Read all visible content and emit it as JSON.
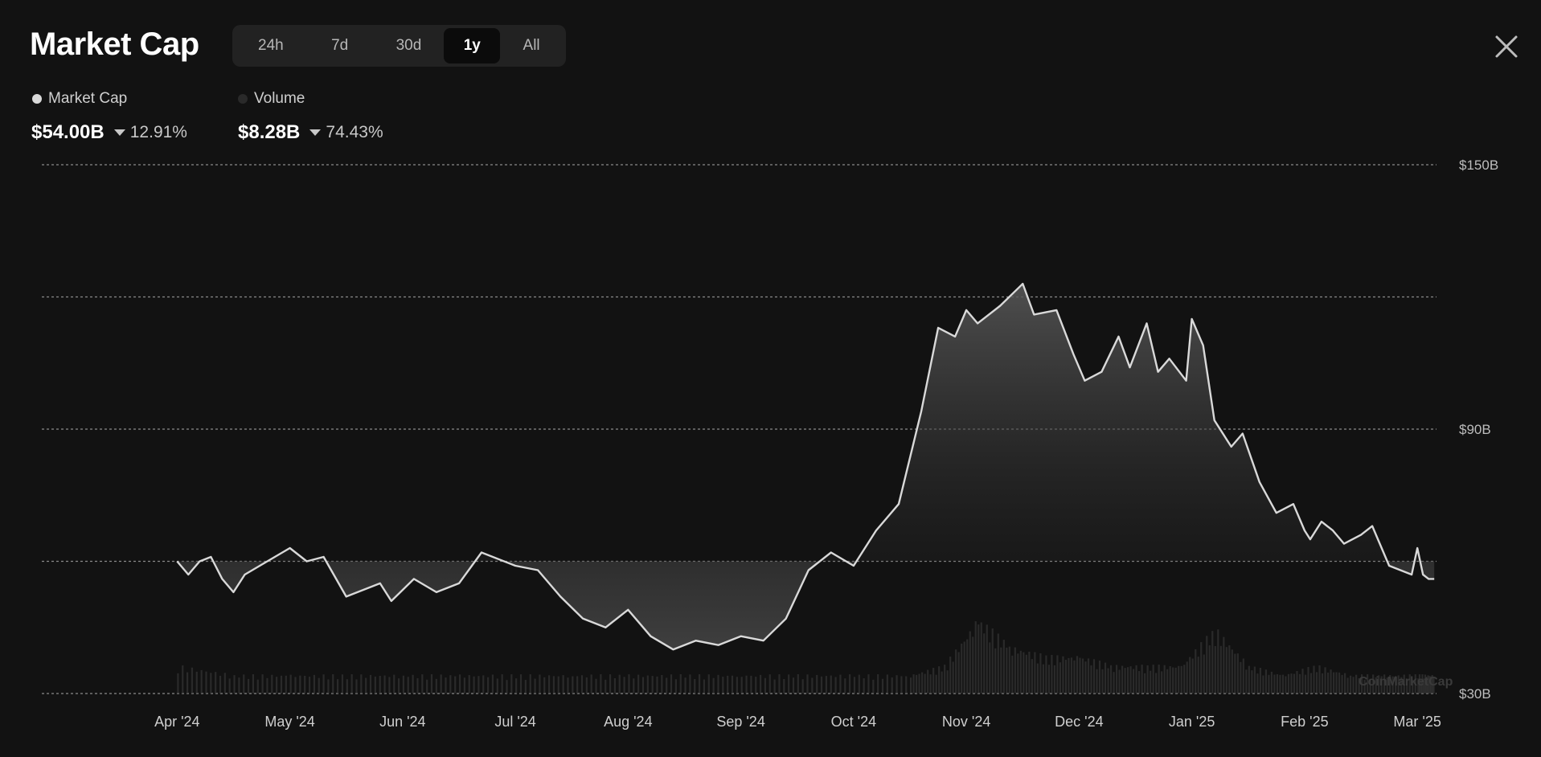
{
  "header": {
    "title": "Market Cap",
    "tabs": [
      {
        "label": "24h",
        "active": false
      },
      {
        "label": "7d",
        "active": false
      },
      {
        "label": "30d",
        "active": false
      },
      {
        "label": "1y",
        "active": true
      },
      {
        "label": "All",
        "active": false
      }
    ],
    "close_icon": "close-icon"
  },
  "legend": {
    "market_cap": {
      "label": "Market Cap",
      "value": "$54.00B",
      "change": "12.91%",
      "direction": "down",
      "color": "#d9d9d9"
    },
    "volume": {
      "label": "Volume",
      "value": "$8.28B",
      "change": "74.43%",
      "direction": "down",
      "color": "#2a2a2a"
    }
  },
  "watermark": "CoinMarketCap",
  "colors": {
    "background": "#121212",
    "line": "#d9d9d9",
    "volume": "#3a3a3a",
    "grid": "#8a8a8a"
  },
  "chart_data": {
    "type": "area",
    "title": "Market Cap",
    "x_tick_labels": [
      "Apr '24",
      "May '24",
      "Jun '24",
      "Jul '24",
      "Aug '24",
      "Sep '24",
      "Oct '24",
      "Nov '24",
      "Dec '24",
      "Jan '25",
      "Feb '25",
      "Mar '25"
    ],
    "y_tick_labels": [
      "$150B",
      "$90B",
      "$30B"
    ],
    "ylim": [
      30,
      150
    ],
    "baseline_value": 60,
    "grid": true,
    "series": [
      {
        "name": "Market Cap",
        "unit": "$B",
        "x": [
          0,
          0.1,
          0.2,
          0.3,
          0.4,
          0.5,
          0.6,
          0.8,
          1.0,
          1.15,
          1.3,
          1.5,
          1.6,
          1.8,
          1.9,
          2.1,
          2.3,
          2.5,
          2.7,
          3.0,
          3.2,
          3.4,
          3.6,
          3.8,
          4.0,
          4.2,
          4.4,
          4.6,
          4.8,
          5.0,
          5.2,
          5.4,
          5.6,
          5.8,
          6.0,
          6.2,
          6.4,
          6.6,
          6.75,
          6.9,
          7.0,
          7.1,
          7.3,
          7.5,
          7.6,
          7.8,
          7.95,
          8.05,
          8.2,
          8.35,
          8.45,
          8.6,
          8.7,
          8.8,
          8.95,
          9.0,
          9.1,
          9.2,
          9.35,
          9.45,
          9.6,
          9.75,
          9.9,
          10.0,
          10.05,
          10.15,
          10.25,
          10.35,
          10.5,
          10.6,
          10.75,
          10.85,
          10.95,
          11.0,
          11.05,
          11.1,
          11.15
        ],
        "values": [
          60,
          57,
          60,
          61,
          56,
          53,
          57,
          60,
          63,
          60,
          61,
          52,
          53,
          55,
          51,
          56,
          53,
          55,
          62,
          59,
          58,
          52,
          47,
          45,
          49,
          43,
          40,
          42,
          41,
          43,
          42,
          47,
          58,
          62,
          59,
          67,
          73,
          94,
          113,
          111,
          117,
          114,
          118,
          123,
          116,
          117,
          107,
          101,
          103,
          111,
          104,
          114,
          103,
          106,
          101,
          115,
          109,
          92,
          86,
          89,
          78,
          71,
          73,
          67,
          65,
          69,
          67,
          64,
          66,
          68,
          59,
          58,
          57,
          63,
          57,
          56,
          56
        ]
      },
      {
        "name": "Volume",
        "unit": "$B",
        "x": [
          0,
          0.5,
          1.0,
          1.5,
          2.0,
          2.5,
          3.0,
          3.5,
          4.0,
          4.5,
          5.0,
          5.5,
          6.0,
          6.5,
          6.8,
          7.1,
          7.4,
          7.7,
          8.0,
          8.3,
          8.6,
          8.9,
          9.2,
          9.5,
          9.8,
          10.1,
          10.4,
          10.7,
          11.0,
          11.15
        ],
        "values": [
          3,
          2,
          2,
          2,
          2,
          2,
          2,
          2,
          2,
          2,
          2,
          2,
          2,
          2,
          3,
          8,
          5,
          4,
          4,
          3,
          3,
          3,
          7,
          3,
          2,
          3,
          2,
          2,
          2,
          2
        ]
      }
    ]
  }
}
